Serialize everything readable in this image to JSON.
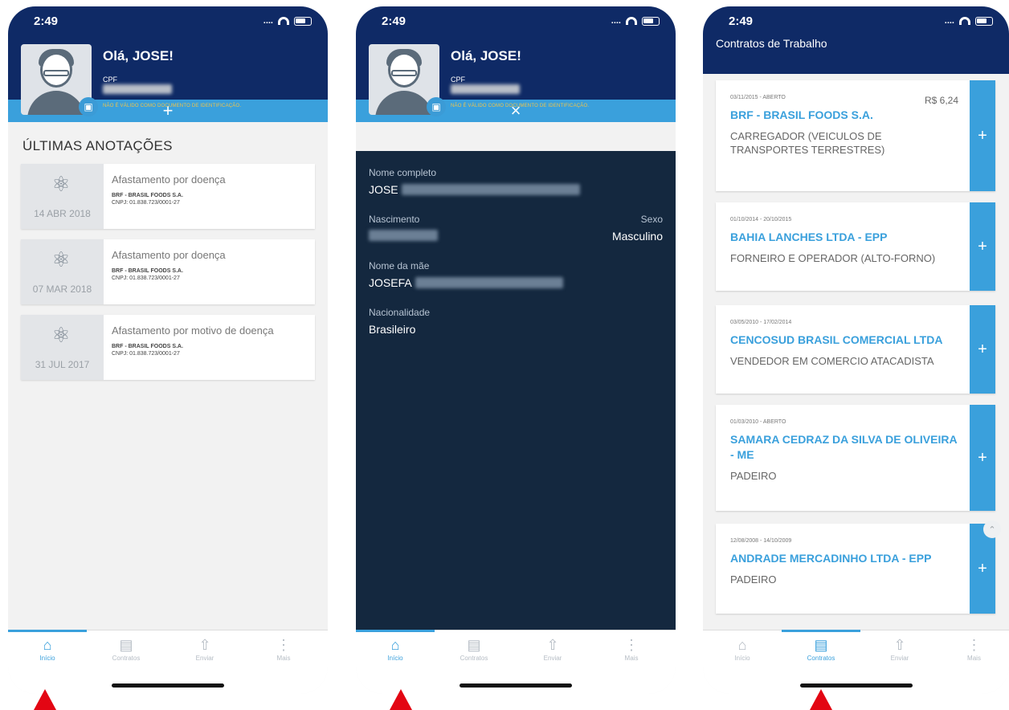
{
  "status": {
    "time": "2:49"
  },
  "profile": {
    "greeting": "Olá, JOSE!",
    "cpf_label": "CPF",
    "notice": "NÃO É VÁLIDO COMO DOCUMENTO DE IDENTIFICAÇÃO."
  },
  "home": {
    "section_title": "ÚLTIMAS ANOTAÇÕES",
    "cards": [
      {
        "date": "14 ABR 2018",
        "title": "Afastamento por doença",
        "company": "BRF - BRASIL FOODS S.A.",
        "cnpj": "CNPJ: 01.838.723/0001-27"
      },
      {
        "date": "07 MAR 2018",
        "title": "Afastamento por doença",
        "company": "BRF - BRASIL FOODS S.A.",
        "cnpj": "CNPJ: 01.838.723/0001-27"
      },
      {
        "date": "31 JUL 2017",
        "title": "Afastamento por motivo de doença",
        "company": "BRF - BRASIL FOODS S.A.",
        "cnpj": "CNPJ: 01.838.723/0001-27"
      }
    ]
  },
  "details": {
    "full_name_label": "Nome completo",
    "full_name_value": "JOSE",
    "birth_label": "Nascimento",
    "sex_label": "Sexo",
    "sex_value": "Masculino",
    "mother_label": "Nome da mãe",
    "mother_value": "JOSEFA",
    "nationality_label": "Nacionalidade",
    "nationality_value": "Brasileiro"
  },
  "contracts": {
    "title": "Contratos de Trabalho",
    "items": [
      {
        "period": "03/11/2015 - ABERTO",
        "value": "R$ 6,24",
        "name": "BRF - BRASIL FOODS S.A.",
        "role": "CARREGADOR (VEICULOS DE TRANSPORTES TERRESTRES)"
      },
      {
        "period": "01/10/2014 - 20/10/2015",
        "name": "BAHIA LANCHES LTDA - EPP",
        "role": "FORNEIRO E OPERADOR (ALTO-FORNO)"
      },
      {
        "period": "03/05/2010 - 17/02/2014",
        "name": "CENCOSUD BRASIL COMERCIAL LTDA",
        "role": "VENDEDOR EM COMERCIO ATACADISTA"
      },
      {
        "period": "01/03/2010 - ABERTO",
        "name": "SAMARA CEDRAZ DA SILVA DE OLIVEIRA - ME",
        "role": "PADEIRO"
      },
      {
        "period": "12/08/2008 - 14/10/2009",
        "name": "ANDRADE MERCADINHO LTDA - EPP",
        "role": "PADEIRO"
      }
    ]
  },
  "tabs": {
    "home": "Início",
    "contracts": "Contratos",
    "send": "Enviar",
    "more": "Mais"
  },
  "colors": {
    "navy": "#0f2a66",
    "accent": "#3aa0dc",
    "dark": "#14283f",
    "marker": "#e30613"
  }
}
